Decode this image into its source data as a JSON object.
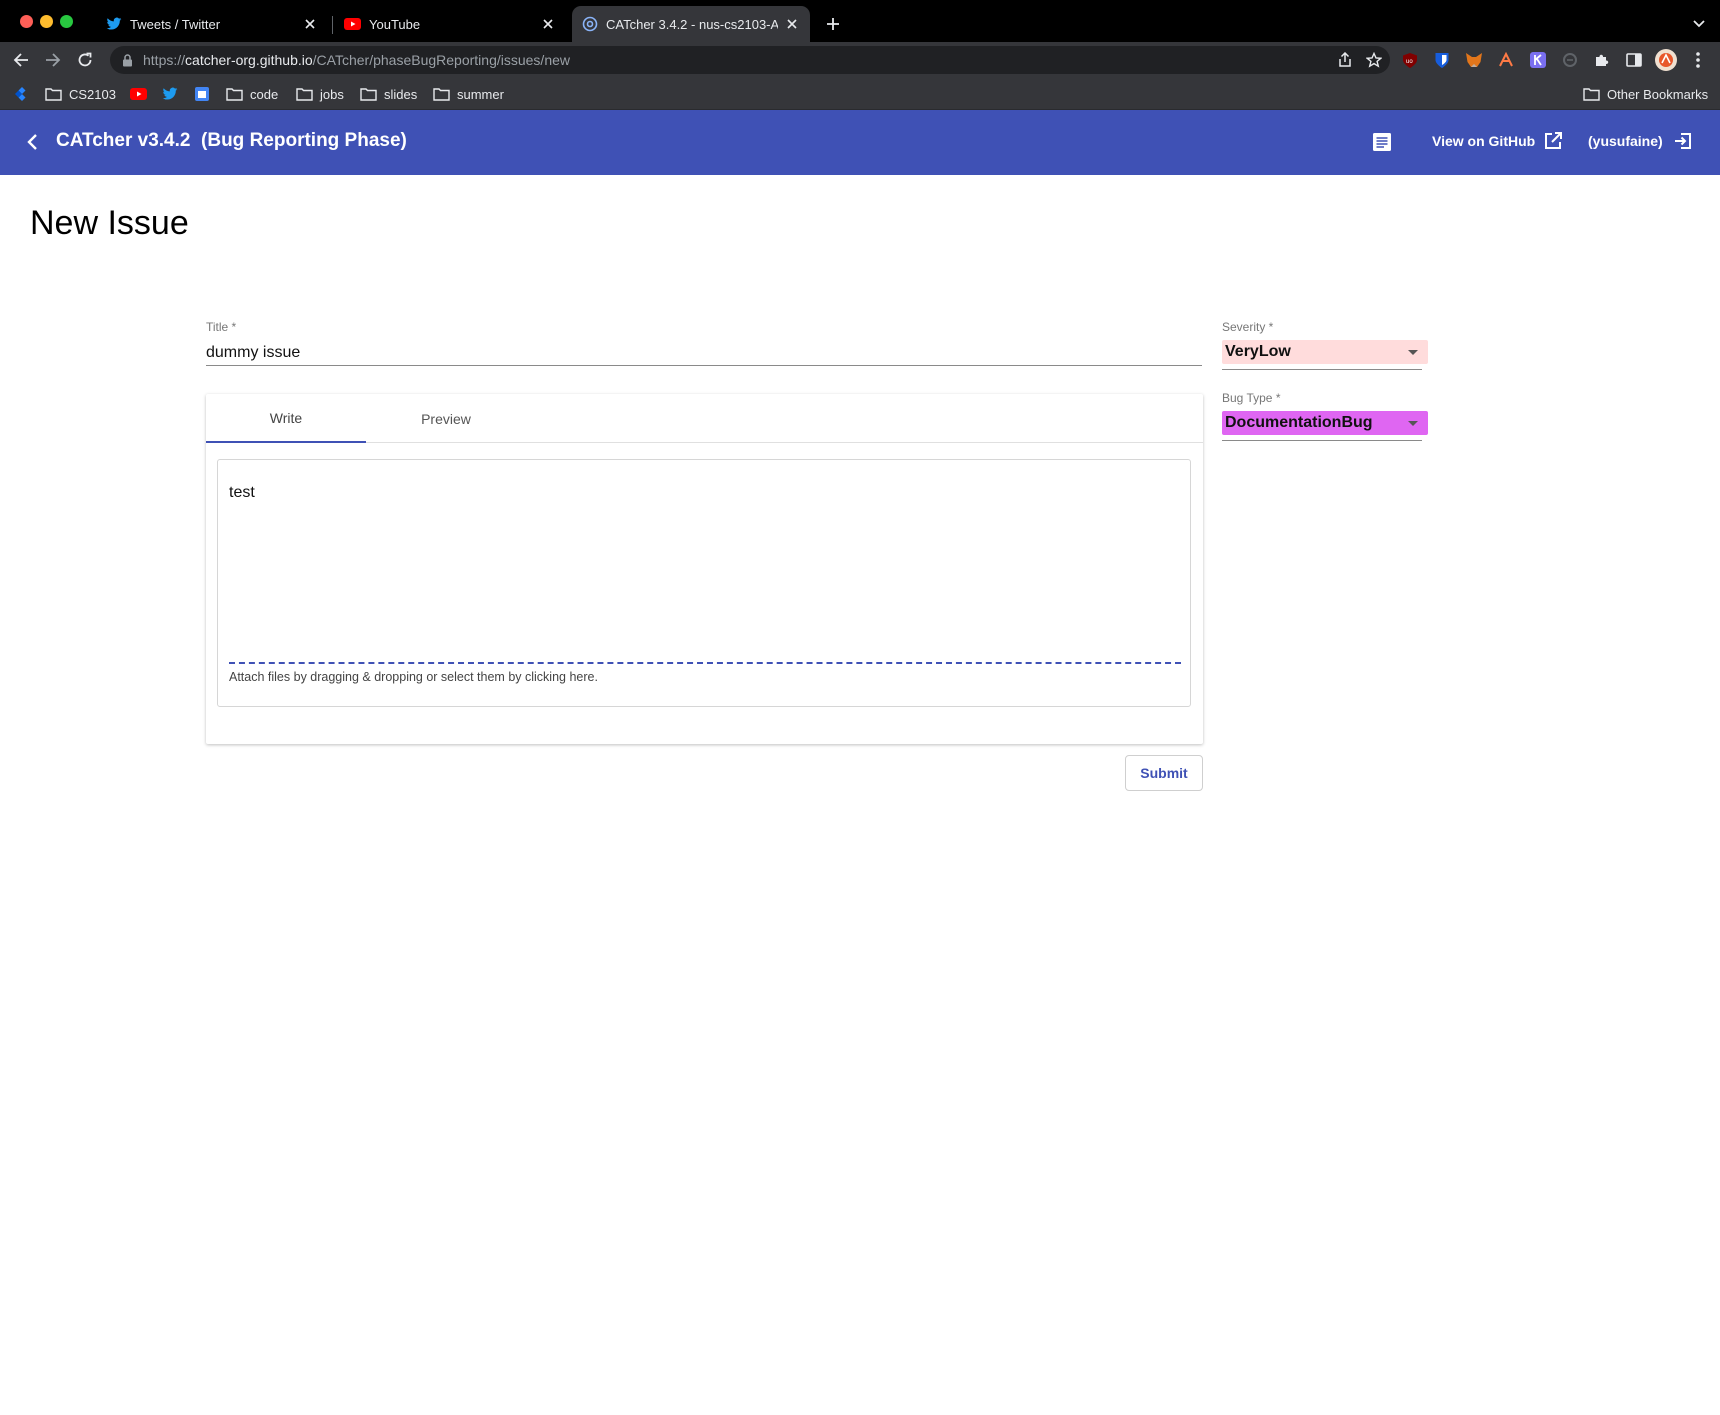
{
  "browser": {
    "tabs": [
      {
        "label": "Tweets / Twitter",
        "icon": "twitter-icon"
      },
      {
        "label": "YouTube",
        "icon": "youtube-icon"
      },
      {
        "label": "CATcher 3.4.2 - nus-cs2103-A",
        "icon": "catcher-icon",
        "active": true
      }
    ],
    "url_scheme": "https://",
    "url_host": "catcher-org.github.io",
    "url_path": "/CATcher/phaseBugReporting/issues/new",
    "bookmarks": {
      "cs2103": "CS2103",
      "code": "code",
      "jobs": "jobs",
      "slides": "slides",
      "summer": "summer",
      "other": "Other Bookmarks"
    }
  },
  "header": {
    "title": "CATcher v3.4.2  (Bug Reporting Phase)",
    "github_link": "View on GitHub",
    "user": "(yusufaine)",
    "color": "#3f51b5"
  },
  "page": {
    "title": "New Issue"
  },
  "form": {
    "title_label": "Title *",
    "title_value": "dummy issue",
    "tabs": {
      "write": "Write",
      "preview": "Preview"
    },
    "body_text": "test",
    "attach_hint": "Attach files by dragging & dropping or select them by clicking here.",
    "submit_label": "Submit",
    "severity_label": "Severity *",
    "severity_value": "VeryLow",
    "severity_color": "#ffdcdc",
    "bug_type_label": "Bug Type *",
    "bug_type_value": "DocumentationBug",
    "bug_type_color": "#df66f2"
  }
}
